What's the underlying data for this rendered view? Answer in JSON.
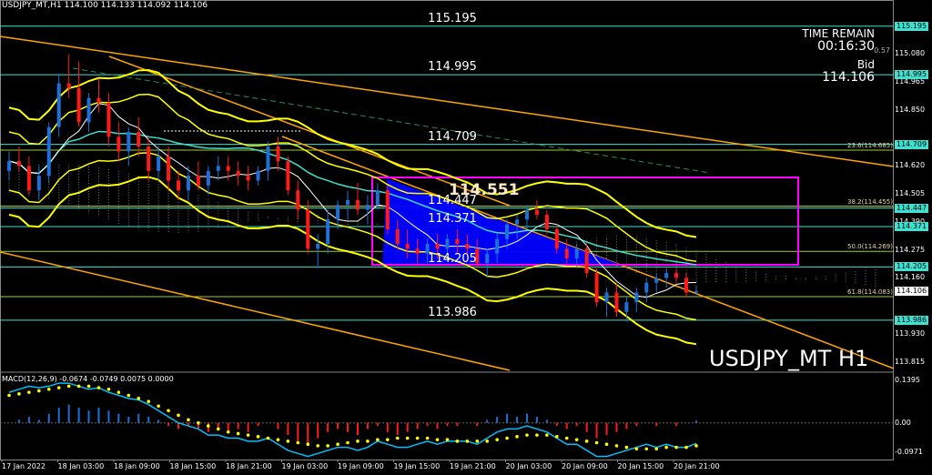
{
  "header": {
    "info": "USDJPY_MT,H1  114.100 114.133 114.092 114.106",
    "macd_info": "MACD(12,26,9) -0.0674 -0.0749 0.0075 0.0000"
  },
  "top_right": {
    "time_remain_label": "TIME REMAIN",
    "time_remain_value": "00:16:30",
    "behind_value": "0.57",
    "bid_label": "Bid",
    "bid_value": "114.106"
  },
  "watermark": "USDJPY_MT H1",
  "box_high_label": "114.551",
  "level_lines": [
    {
      "text": "115.195",
      "value": 115.195
    },
    {
      "text": "114.995",
      "value": 114.995
    },
    {
      "text": "114.709",
      "value": 114.709
    },
    {
      "text": "114.447",
      "value": 114.447
    },
    {
      "text": "114.371",
      "value": 114.371
    },
    {
      "text": "114.205",
      "value": 114.205
    },
    {
      "text": "113.986",
      "value": 113.986
    }
  ],
  "fib_labels": [
    {
      "text": "23.6(114.685)",
      "value": 114.685
    },
    {
      "text": "38.2(114.455)",
      "value": 114.455
    },
    {
      "text": "50.0(114.269)",
      "value": 114.269
    },
    {
      "text": "61.8(114.083)",
      "value": 114.083
    }
  ],
  "price_axis": {
    "ticks": [
      "115.080",
      "114.965",
      "114.850",
      "114.620",
      "114.505",
      "114.390",
      "114.275",
      "114.160",
      "113.930",
      "113.815"
    ],
    "boxed": [
      {
        "text": "115.195",
        "value": 115.195,
        "bg": "#40e0d0",
        "fg": "#000000"
      },
      {
        "text": "114.995",
        "value": 114.995,
        "bg": "#40e0d0",
        "fg": "#000000"
      },
      {
        "text": "114.709",
        "value": 114.709,
        "bg": "#40e0d0",
        "fg": "#000000"
      },
      {
        "text": "114.447",
        "value": 114.447,
        "bg": "#40e0d0",
        "fg": "#000000"
      },
      {
        "text": "114.371",
        "value": 114.371,
        "bg": "#40e0d0",
        "fg": "#000000"
      },
      {
        "text": "114.205",
        "value": 114.205,
        "bg": "#40e0d0",
        "fg": "#000000"
      },
      {
        "text": "114.106",
        "value": 114.106,
        "bg": "#ffffff",
        "fg": "#000000"
      },
      {
        "text": "113.986",
        "value": 113.986,
        "bg": "#40e0d0",
        "fg": "#000000"
      }
    ]
  },
  "macd_axis": [
    "0.1395",
    "0.00",
    "-0.0971"
  ],
  "time_axis": [
    "17 Jan 2022",
    "18 Jan 03:00",
    "18 Jan 09:00",
    "18 Jan 15:00",
    "18 Jan 21:00",
    "19 Jan 03:00",
    "19 Jan 09:00",
    "19 Jan 15:00",
    "19 Jan 21:00",
    "20 Jan 03:00",
    "20 Jan 09:00",
    "20 Jan 15:00",
    "20 Jan 21:00"
  ],
  "colors": {
    "bull": "#1e6fd9",
    "bear": "#ff1a1a",
    "level_line": "#40e0d0",
    "fib_line": "#9acd32",
    "trend": "#ffa500",
    "bollinger": "#ffff00",
    "box": "#ff00ff",
    "triangle": "#0000ff",
    "macd_signal": "#ffff00",
    "macd_line": "#00bfff"
  },
  "chart_data": {
    "type": "candlestick",
    "symbol": "USDJPY_MT",
    "timeframe": "H1",
    "ylim": [
      113.78,
      115.25
    ],
    "candles": [
      [
        114.6,
        114.68,
        114.56,
        114.64
      ],
      [
        114.64,
        114.7,
        114.6,
        114.62
      ],
      [
        114.62,
        114.66,
        114.5,
        114.52
      ],
      [
        114.52,
        114.62,
        114.48,
        114.58
      ],
      [
        114.58,
        114.8,
        114.55,
        114.78
      ],
      [
        114.78,
        115.0,
        114.74,
        114.96
      ],
      [
        114.96,
        115.08,
        114.9,
        114.94
      ],
      [
        114.94,
        115.05,
        114.78,
        114.8
      ],
      [
        114.8,
        114.92,
        114.76,
        114.9
      ],
      [
        114.9,
        114.98,
        114.84,
        114.88
      ],
      [
        114.88,
        114.92,
        114.7,
        114.74
      ],
      [
        114.74,
        114.8,
        114.64,
        114.68
      ],
      [
        114.68,
        114.78,
        114.62,
        114.76
      ],
      [
        114.76,
        114.82,
        114.66,
        114.7
      ],
      [
        114.7,
        114.74,
        114.56,
        114.6
      ],
      [
        114.6,
        114.7,
        114.56,
        114.66
      ],
      [
        114.66,
        114.7,
        114.52,
        114.56
      ],
      [
        114.56,
        114.6,
        114.48,
        114.52
      ],
      [
        114.52,
        114.62,
        114.48,
        114.58
      ],
      [
        114.58,
        114.64,
        114.52,
        114.54
      ],
      [
        114.54,
        114.62,
        114.5,
        114.6
      ],
      [
        114.6,
        114.66,
        114.56,
        114.62
      ],
      [
        114.62,
        114.66,
        114.56,
        114.6
      ],
      [
        114.6,
        114.64,
        114.54,
        114.58
      ],
      [
        114.58,
        114.62,
        114.52,
        114.56
      ],
      [
        114.56,
        114.62,
        114.54,
        114.6
      ],
      [
        114.6,
        114.72,
        114.56,
        114.7
      ],
      [
        114.7,
        114.74,
        114.6,
        114.64
      ],
      [
        114.64,
        114.66,
        114.5,
        114.52
      ],
      [
        114.52,
        114.56,
        114.4,
        114.44
      ],
      [
        114.44,
        114.48,
        114.26,
        114.28
      ],
      [
        114.28,
        114.34,
        114.2,
        114.3
      ],
      [
        114.3,
        114.44,
        114.26,
        114.4
      ],
      [
        114.4,
        114.48,
        114.36,
        114.46
      ],
      [
        114.46,
        114.52,
        114.4,
        114.48
      ],
      [
        114.48,
        114.55,
        114.42,
        114.44
      ],
      [
        114.44,
        114.5,
        114.38,
        114.46
      ],
      [
        114.46,
        114.55,
        114.44,
        114.52
      ],
      [
        114.52,
        114.54,
        114.34,
        114.36
      ],
      [
        114.36,
        114.4,
        114.28,
        114.3
      ],
      [
        114.3,
        114.36,
        114.24,
        114.28
      ],
      [
        114.28,
        114.32,
        114.22,
        114.26
      ],
      [
        114.26,
        114.32,
        114.22,
        114.3
      ],
      [
        114.3,
        114.34,
        114.24,
        114.28
      ],
      [
        114.28,
        114.34,
        114.26,
        114.32
      ],
      [
        114.32,
        114.36,
        114.26,
        114.3
      ],
      [
        114.3,
        114.34,
        114.26,
        114.28
      ],
      [
        114.28,
        114.32,
        114.2,
        114.22
      ],
      [
        114.22,
        114.28,
        114.16,
        114.26
      ],
      [
        114.26,
        114.34,
        114.22,
        114.32
      ],
      [
        114.32,
        114.4,
        114.28,
        114.38
      ],
      [
        114.38,
        114.42,
        114.32,
        114.4
      ],
      [
        114.4,
        114.46,
        114.36,
        114.44
      ],
      [
        114.44,
        114.48,
        114.4,
        114.42
      ],
      [
        114.42,
        114.44,
        114.34,
        114.36
      ],
      [
        114.36,
        114.38,
        114.26,
        114.28
      ],
      [
        114.28,
        114.32,
        114.22,
        114.24
      ],
      [
        114.24,
        114.3,
        114.2,
        114.28
      ],
      [
        114.28,
        114.3,
        114.16,
        114.18
      ],
      [
        114.18,
        114.2,
        114.04,
        114.06
      ],
      [
        114.06,
        114.12,
        114.0,
        114.1
      ],
      [
        114.1,
        114.14,
        114.0,
        114.02
      ],
      [
        114.02,
        114.08,
        113.98,
        114.06
      ],
      [
        114.06,
        114.12,
        114.02,
        114.1
      ],
      [
        114.1,
        114.16,
        114.06,
        114.14
      ],
      [
        114.14,
        114.18,
        114.1,
        114.16
      ],
      [
        114.16,
        114.2,
        114.12,
        114.18
      ],
      [
        114.18,
        114.2,
        114.14,
        114.16
      ],
      [
        114.16,
        114.18,
        114.08,
        114.1
      ],
      [
        114.1,
        114.13,
        114.09,
        114.106
      ]
    ],
    "macd_range": [
      -0.12,
      0.16
    ],
    "macd_hist": [
      0.0,
      0.01,
      0.02,
      0.01,
      0.03,
      0.05,
      0.06,
      0.05,
      0.04,
      0.05,
      0.04,
      0.03,
      0.02,
      0.03,
      0.02,
      0.01,
      -0.01,
      -0.02,
      -0.01,
      -0.02,
      -0.03,
      -0.02,
      -0.03,
      -0.02,
      -0.03,
      -0.01,
      0.0,
      -0.02,
      -0.04,
      -0.06,
      -0.07,
      -0.05,
      -0.03,
      -0.02,
      -0.03,
      -0.04,
      -0.02,
      -0.01,
      -0.03,
      -0.04,
      -0.03,
      -0.02,
      -0.01,
      -0.02,
      -0.01,
      -0.01,
      0.0,
      -0.01,
      0.01,
      0.02,
      0.03,
      0.02,
      0.03,
      0.02,
      0.01,
      -0.01,
      -0.02,
      -0.01,
      -0.03,
      -0.05,
      -0.04,
      -0.03,
      -0.02,
      -0.01,
      0.0,
      -0.01,
      0.0,
      -0.01,
      0.0,
      0.0075
    ],
    "macd_signal": [
      0.09,
      0.095,
      0.1,
      0.105,
      0.11,
      0.115,
      0.12,
      0.12,
      0.12,
      0.115,
      0.11,
      0.1,
      0.09,
      0.08,
      0.07,
      0.055,
      0.04,
      0.025,
      0.01,
      0.0,
      -0.01,
      -0.02,
      -0.03,
      -0.035,
      -0.04,
      -0.045,
      -0.05,
      -0.055,
      -0.06,
      -0.065,
      -0.07,
      -0.075,
      -0.075,
      -0.07,
      -0.065,
      -0.06,
      -0.06,
      -0.055,
      -0.055,
      -0.05,
      -0.05,
      -0.05,
      -0.05,
      -0.055,
      -0.055,
      -0.06,
      -0.06,
      -0.06,
      -0.06,
      -0.055,
      -0.05,
      -0.045,
      -0.04,
      -0.04,
      -0.04,
      -0.045,
      -0.05,
      -0.055,
      -0.06,
      -0.065,
      -0.07,
      -0.075,
      -0.08,
      -0.085,
      -0.085,
      -0.085,
      -0.08,
      -0.08,
      -0.08,
      -0.0749
    ],
    "macd_line": [
      0.1,
      0.11,
      0.12,
      0.115,
      0.12,
      0.13,
      0.13,
      0.12,
      0.11,
      0.115,
      0.1,
      0.09,
      0.08,
      0.075,
      0.06,
      0.04,
      0.02,
      0.0,
      -0.01,
      -0.02,
      -0.04,
      -0.04,
      -0.05,
      -0.05,
      -0.06,
      -0.06,
      -0.05,
      -0.07,
      -0.09,
      -0.1,
      -0.11,
      -0.1,
      -0.09,
      -0.08,
      -0.08,
      -0.09,
      -0.08,
      -0.06,
      -0.07,
      -0.08,
      -0.08,
      -0.07,
      -0.06,
      -0.07,
      -0.06,
      -0.06,
      -0.06,
      -0.07,
      -0.05,
      -0.03,
      -0.02,
      -0.02,
      -0.01,
      -0.02,
      -0.03,
      -0.05,
      -0.07,
      -0.07,
      -0.09,
      -0.11,
      -0.11,
      -0.1,
      -0.09,
      -0.08,
      -0.07,
      -0.08,
      -0.07,
      -0.08,
      -0.08,
      -0.0674
    ]
  }
}
